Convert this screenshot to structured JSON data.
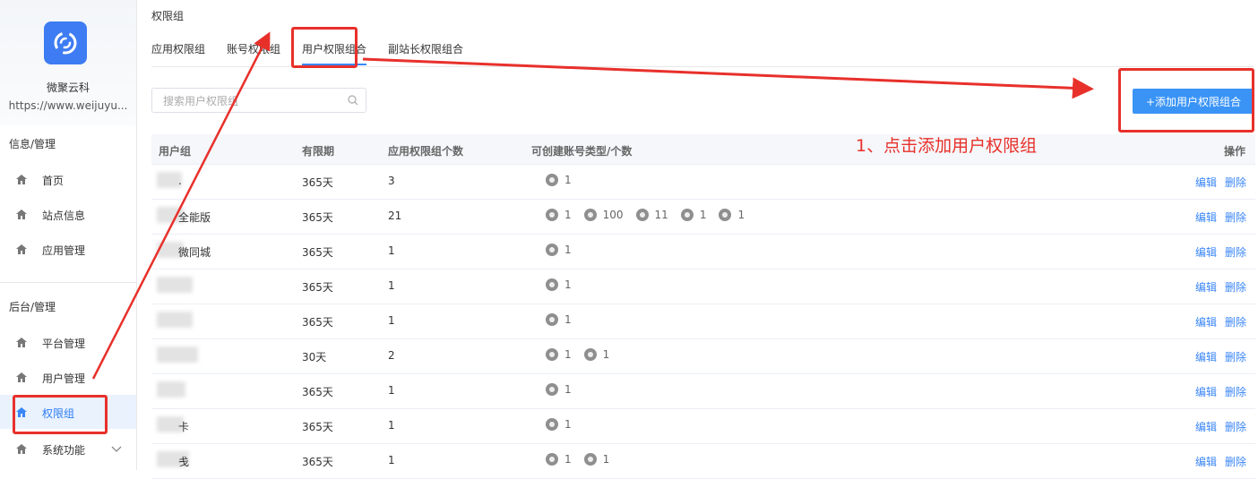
{
  "sidebar": {
    "brand_name": "微聚云科",
    "brand_url": "https://www.weijuyu...",
    "section1": "信息/管理",
    "section2": "后台/管理",
    "items": [
      {
        "label": "首页"
      },
      {
        "label": "站点信息"
      },
      {
        "label": "应用管理"
      },
      {
        "label": "平台管理"
      },
      {
        "label": "用户管理"
      },
      {
        "label": "权限组"
      },
      {
        "label": "系统功能"
      }
    ]
  },
  "main": {
    "title": "权限组",
    "tabs": [
      {
        "label": "应用权限组"
      },
      {
        "label": "账号权限组"
      },
      {
        "label": "用户权限组合"
      },
      {
        "label": "副站长权限组合"
      }
    ],
    "search_placeholder": "搜索用户权限组",
    "add_button": "+添加用户权限组合",
    "annotation": "1、点击添加用户权限组"
  },
  "table": {
    "headers": [
      "用户组",
      "有限期",
      "应用权限组个数",
      "可创建账号类型/个数",
      "操作"
    ],
    "rows": [
      {
        "name": ".",
        "period": "365天",
        "count": "3",
        "badges": [
          {
            "icon": "miniprogram-icon",
            "n": "1"
          }
        ]
      },
      {
        "name": "全能版",
        "period": "365天",
        "count": "21",
        "badges": [
          {
            "icon": "wechat-icon",
            "n": "1"
          },
          {
            "icon": "miniprogram-icon",
            "n": "100"
          },
          {
            "icon": "pc-icon",
            "n": "11"
          },
          {
            "icon": "mobile-icon",
            "n": "1"
          },
          {
            "icon": "alipay-icon",
            "n": "1"
          }
        ]
      },
      {
        "name": "微同城",
        "period": "365天",
        "count": "1",
        "badges": [
          {
            "icon": "wechat-icon",
            "n": "1"
          }
        ]
      },
      {
        "name": "",
        "period": "365天",
        "count": "1",
        "badges": [
          {
            "icon": "miniprogram-icon",
            "n": "1"
          }
        ]
      },
      {
        "name": "",
        "period": "365天",
        "count": "1",
        "badges": [
          {
            "icon": "miniprogram-icon",
            "n": "1"
          }
        ]
      },
      {
        "name": "",
        "period": "30天",
        "count": "2",
        "badges": [
          {
            "icon": "wechat-icon",
            "n": "1"
          },
          {
            "icon": "miniprogram-icon",
            "n": "1"
          }
        ]
      },
      {
        "name": "",
        "period": "365天",
        "count": "1",
        "badges": [
          {
            "icon": "wechat-icon",
            "n": "1"
          }
        ]
      },
      {
        "name": "卡",
        "period": "365天",
        "count": "1",
        "badges": [
          {
            "icon": "wechat-icon",
            "n": "1"
          }
        ]
      },
      {
        "name": "戋",
        "period": "365天",
        "count": "1",
        "badges": [
          {
            "icon": "wechat-icon",
            "n": "1"
          },
          {
            "icon": "miniprogram-icon",
            "n": "1"
          }
        ]
      }
    ],
    "edit_label": "编辑",
    "delete_label": "删除"
  },
  "colors": {
    "accent": "#3a94f6",
    "annotation": "#e8302b",
    "link": "#3a86f7"
  }
}
